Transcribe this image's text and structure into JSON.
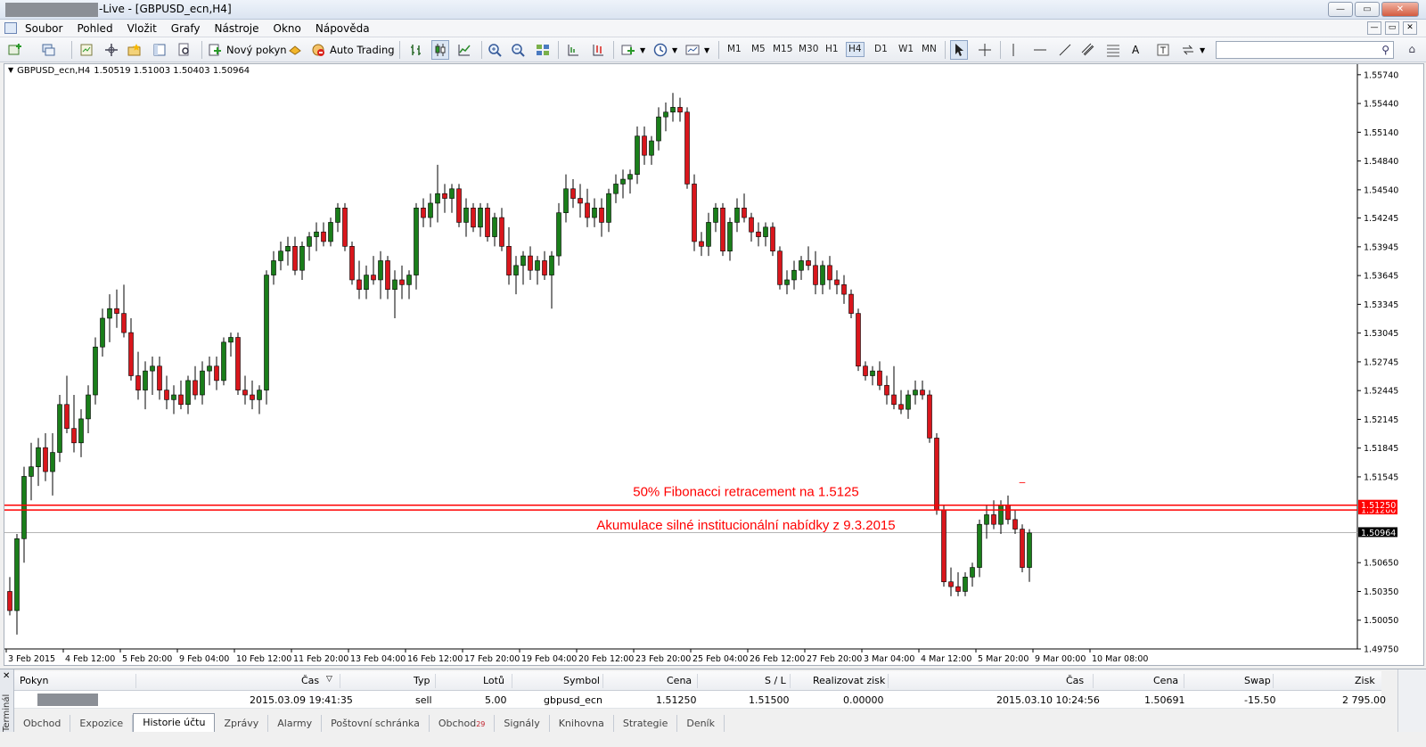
{
  "window": {
    "title": "-Live - [GBPUSD_ecn,H4]",
    "minimize": "—",
    "maximize": "▭",
    "close": "✕"
  },
  "menu": [
    "Soubor",
    "Pohled",
    "Vložit",
    "Grafy",
    "Nástroje",
    "Okno",
    "Nápověda"
  ],
  "toolbar": {
    "new_order": "Nový pokyn",
    "auto_trading": "Auto Trading",
    "timeframes": [
      "M1",
      "M5",
      "M15",
      "M30",
      "H1",
      "H4",
      "D1",
      "W1",
      "MN"
    ],
    "active_timeframe": "H4",
    "draw_text": "A"
  },
  "chart_header": {
    "symbol": "GBPUSD_ecn,H4",
    "ohlc": "1.50519 1.51003 1.50403 1.50964"
  },
  "annotations": {
    "fib": "50% Fibonacci retracement na 1.5125",
    "zone": "Akumulace silné institucionální nabídky z 9.3.2015",
    "marker_symbol": "–"
  },
  "colors": {
    "bull": "#1a7e1a",
    "bear": "#d9161c",
    "line_red": "#ff0000",
    "grid": "#ffffff",
    "price_bg": "#000000"
  },
  "chart_data": {
    "type": "candlestick",
    "ylim": [
      1.4975,
      1.5585
    ],
    "y_ticks": [
      "1.55740",
      "1.55440",
      "1.55140",
      "1.54840",
      "1.54540",
      "1.54245",
      "1.53945",
      "1.53645",
      "1.53345",
      "1.53045",
      "1.52745",
      "1.52445",
      "1.52145",
      "1.51845",
      "1.51545",
      "1.50650",
      "1.50350",
      "1.50050",
      "1.49750"
    ],
    "x_ticks": [
      "3 Feb 2015",
      "4 Feb 12:00",
      "5 Feb 20:00",
      "9 Feb 04:00",
      "10 Feb 12:00",
      "11 Feb 20:00",
      "13 Feb 04:00",
      "16 Feb 12:00",
      "17 Feb 20:00",
      "19 Feb 04:00",
      "20 Feb 12:00",
      "23 Feb 20:00",
      "25 Feb 04:00",
      "26 Feb 12:00",
      "27 Feb 20:00",
      "3 Mar 04:00",
      "4 Mar 12:00",
      "5 Mar 20:00",
      "9 Mar 00:00",
      "10 Mar 08:00"
    ],
    "hlines": [
      {
        "price": 1.5125,
        "label": "1.51250"
      },
      {
        "price": 1.512,
        "label": "1.51200"
      }
    ],
    "current_price": {
      "price": 1.50964,
      "label": "1.50964"
    },
    "candles": [
      [
        1.5035,
        1.505,
        1.501,
        1.5015
      ],
      [
        1.5015,
        1.5095,
        1.499,
        1.509
      ],
      [
        1.509,
        1.5165,
        1.5065,
        1.5155
      ],
      [
        1.5155,
        1.519,
        1.513,
        1.5165
      ],
      [
        1.5165,
        1.5195,
        1.5145,
        1.5185
      ],
      [
        1.5185,
        1.52,
        1.515,
        1.516
      ],
      [
        1.516,
        1.52,
        1.5135,
        1.518
      ],
      [
        1.518,
        1.524,
        1.517,
        1.523
      ],
      [
        1.523,
        1.526,
        1.52,
        1.5205
      ],
      [
        1.5205,
        1.524,
        1.518,
        1.519
      ],
      [
        1.519,
        1.5225,
        1.5175,
        1.5215
      ],
      [
        1.5215,
        1.525,
        1.52,
        1.524
      ],
      [
        1.524,
        1.53,
        1.523,
        1.529
      ],
      [
        1.529,
        1.533,
        1.528,
        1.532
      ],
      [
        1.532,
        1.5345,
        1.5295,
        1.533
      ],
      [
        1.533,
        1.535,
        1.531,
        1.5325
      ],
      [
        1.5325,
        1.5355,
        1.53,
        1.5305
      ],
      [
        1.5305,
        1.532,
        1.5255,
        1.526
      ],
      [
        1.526,
        1.5285,
        1.5235,
        1.5245
      ],
      [
        1.5245,
        1.5275,
        1.5225,
        1.5265
      ],
      [
        1.5265,
        1.528,
        1.524,
        1.527
      ],
      [
        1.527,
        1.528,
        1.5235,
        1.5245
      ],
      [
        1.5245,
        1.526,
        1.5225,
        1.5235
      ],
      [
        1.5235,
        1.525,
        1.522,
        1.524
      ],
      [
        1.524,
        1.5255,
        1.5225,
        1.523
      ],
      [
        1.523,
        1.526,
        1.522,
        1.5255
      ],
      [
        1.5255,
        1.527,
        1.5235,
        1.524
      ],
      [
        1.524,
        1.5275,
        1.523,
        1.5265
      ],
      [
        1.5265,
        1.528,
        1.525,
        1.527
      ],
      [
        1.527,
        1.528,
        1.5245,
        1.5255
      ],
      [
        1.5255,
        1.53,
        1.525,
        1.5295
      ],
      [
        1.5295,
        1.5305,
        1.528,
        1.53
      ],
      [
        1.53,
        1.5305,
        1.524,
        1.5245
      ],
      [
        1.5245,
        1.526,
        1.523,
        1.524
      ],
      [
        1.524,
        1.5255,
        1.5225,
        1.5235
      ],
      [
        1.5235,
        1.525,
        1.522,
        1.5245
      ],
      [
        1.5245,
        1.537,
        1.523,
        1.5365
      ],
      [
        1.5365,
        1.539,
        1.5355,
        1.538
      ],
      [
        1.538,
        1.54,
        1.537,
        1.539
      ],
      [
        1.539,
        1.5405,
        1.5375,
        1.5395
      ],
      [
        1.5395,
        1.5405,
        1.5365,
        1.537
      ],
      [
        1.537,
        1.54,
        1.536,
        1.5395
      ],
      [
        1.5395,
        1.541,
        1.538,
        1.5405
      ],
      [
        1.5405,
        1.542,
        1.539,
        1.541
      ],
      [
        1.541,
        1.542,
        1.5395,
        1.54
      ],
      [
        1.54,
        1.5425,
        1.5395,
        1.542
      ],
      [
        1.542,
        1.544,
        1.541,
        1.5435
      ],
      [
        1.5435,
        1.544,
        1.539,
        1.5395
      ],
      [
        1.5395,
        1.54,
        1.5355,
        1.536
      ],
      [
        1.536,
        1.538,
        1.534,
        1.535
      ],
      [
        1.535,
        1.5375,
        1.534,
        1.5365
      ],
      [
        1.5365,
        1.5385,
        1.5355,
        1.536
      ],
      [
        1.536,
        1.539,
        1.534,
        1.538
      ],
      [
        1.538,
        1.5385,
        1.534,
        1.535
      ],
      [
        1.535,
        1.537,
        1.532,
        1.536
      ],
      [
        1.536,
        1.5375,
        1.534,
        1.5355
      ],
      [
        1.5355,
        1.537,
        1.534,
        1.5365
      ],
      [
        1.5365,
        1.544,
        1.535,
        1.5435
      ],
      [
        1.5435,
        1.5445,
        1.5415,
        1.5425
      ],
      [
        1.5425,
        1.545,
        1.5415,
        1.544
      ],
      [
        1.544,
        1.548,
        1.542,
        1.545
      ],
      [
        1.545,
        1.546,
        1.543,
        1.5445
      ],
      [
        1.5445,
        1.546,
        1.543,
        1.5455
      ],
      [
        1.5455,
        1.546,
        1.5415,
        1.542
      ],
      [
        1.542,
        1.5445,
        1.5405,
        1.5435
      ],
      [
        1.5435,
        1.544,
        1.541,
        1.5415
      ],
      [
        1.5415,
        1.544,
        1.5405,
        1.5435
      ],
      [
        1.5435,
        1.544,
        1.54,
        1.5405
      ],
      [
        1.5405,
        1.543,
        1.5395,
        1.5425
      ],
      [
        1.5425,
        1.5435,
        1.539,
        1.5395
      ],
      [
        1.5395,
        1.5415,
        1.5355,
        1.5365
      ],
      [
        1.5365,
        1.5385,
        1.5345,
        1.5375
      ],
      [
        1.5375,
        1.539,
        1.5355,
        1.5385
      ],
      [
        1.5385,
        1.5395,
        1.536,
        1.537
      ],
      [
        1.537,
        1.5385,
        1.5355,
        1.538
      ],
      [
        1.538,
        1.539,
        1.536,
        1.5365
      ],
      [
        1.5365,
        1.539,
        1.533,
        1.5385
      ],
      [
        1.5385,
        1.544,
        1.5375,
        1.543
      ],
      [
        1.543,
        1.547,
        1.542,
        1.5455
      ],
      [
        1.5455,
        1.5465,
        1.5435,
        1.5445
      ],
      [
        1.5445,
        1.546,
        1.5425,
        1.544
      ],
      [
        1.544,
        1.5455,
        1.5415,
        1.5425
      ],
      [
        1.5425,
        1.5445,
        1.5415,
        1.5435
      ],
      [
        1.5435,
        1.5445,
        1.5405,
        1.542
      ],
      [
        1.542,
        1.5455,
        1.541,
        1.545
      ],
      [
        1.545,
        1.547,
        1.544,
        1.546
      ],
      [
        1.546,
        1.5475,
        1.5445,
        1.5465
      ],
      [
        1.5465,
        1.5475,
        1.545,
        1.547
      ],
      [
        1.547,
        1.552,
        1.546,
        1.551
      ],
      [
        1.551,
        1.552,
        1.548,
        1.549
      ],
      [
        1.549,
        1.551,
        1.548,
        1.5505
      ],
      [
        1.5505,
        1.554,
        1.5495,
        1.553
      ],
      [
        1.553,
        1.5545,
        1.5515,
        1.5535
      ],
      [
        1.5535,
        1.5555,
        1.5525,
        1.554
      ],
      [
        1.554,
        1.555,
        1.5525,
        1.5535
      ],
      [
        1.5535,
        1.554,
        1.5455,
        1.546
      ],
      [
        1.546,
        1.547,
        1.539,
        1.54
      ],
      [
        1.54,
        1.541,
        1.5385,
        1.5395
      ],
      [
        1.5395,
        1.543,
        1.5385,
        1.542
      ],
      [
        1.542,
        1.544,
        1.541,
        1.5435
      ],
      [
        1.5435,
        1.544,
        1.5385,
        1.539
      ],
      [
        1.539,
        1.5425,
        1.538,
        1.542
      ],
      [
        1.542,
        1.5445,
        1.541,
        1.5435
      ],
      [
        1.5435,
        1.545,
        1.542,
        1.5425
      ],
      [
        1.5425,
        1.543,
        1.54,
        1.541
      ],
      [
        1.541,
        1.542,
        1.5395,
        1.5405
      ],
      [
        1.5405,
        1.542,
        1.5395,
        1.5415
      ],
      [
        1.5415,
        1.542,
        1.5385,
        1.539
      ],
      [
        1.539,
        1.5395,
        1.535,
        1.5355
      ],
      [
        1.5355,
        1.537,
        1.5345,
        1.536
      ],
      [
        1.536,
        1.538,
        1.535,
        1.537
      ],
      [
        1.537,
        1.5385,
        1.536,
        1.538
      ],
      [
        1.538,
        1.5395,
        1.537,
        1.5375
      ],
      [
        1.5375,
        1.539,
        1.5345,
        1.5355
      ],
      [
        1.5355,
        1.538,
        1.5345,
        1.5375
      ],
      [
        1.5375,
        1.5385,
        1.535,
        1.536
      ],
      [
        1.536,
        1.537,
        1.5345,
        1.5355
      ],
      [
        1.5355,
        1.5365,
        1.5335,
        1.5345
      ],
      [
        1.5345,
        1.535,
        1.532,
        1.5325
      ],
      [
        1.5325,
        1.533,
        1.5265,
        1.527
      ],
      [
        1.527,
        1.5275,
        1.5255,
        1.526
      ],
      [
        1.526,
        1.527,
        1.525,
        1.5265
      ],
      [
        1.5265,
        1.5275,
        1.5245,
        1.525
      ],
      [
        1.525,
        1.526,
        1.523,
        1.524
      ],
      [
        1.524,
        1.527,
        1.5225,
        1.523
      ],
      [
        1.523,
        1.5245,
        1.522,
        1.5225
      ],
      [
        1.5225,
        1.5245,
        1.5215,
        1.524
      ],
      [
        1.524,
        1.5255,
        1.523,
        1.5245
      ],
      [
        1.5245,
        1.5255,
        1.5235,
        1.524
      ],
      [
        1.524,
        1.5245,
        1.519,
        1.5195
      ],
      [
        1.5195,
        1.52,
        1.5115,
        1.512
      ],
      [
        1.512,
        1.5125,
        1.504,
        1.5045
      ],
      [
        1.5045,
        1.506,
        1.503,
        1.504
      ],
      [
        1.504,
        1.5055,
        1.503,
        1.5035
      ],
      [
        1.5035,
        1.5055,
        1.503,
        1.505
      ],
      [
        1.505,
        1.5065,
        1.504,
        1.506
      ],
      [
        1.506,
        1.511,
        1.505,
        1.5105
      ],
      [
        1.5105,
        1.5125,
        1.509,
        1.5115
      ],
      [
        1.5115,
        1.513,
        1.51,
        1.5105
      ],
      [
        1.5105,
        1.513,
        1.5095,
        1.5125
      ],
      [
        1.5125,
        1.5135,
        1.5105,
        1.511
      ],
      [
        1.511,
        1.512,
        1.5095,
        1.51
      ],
      [
        1.51,
        1.5105,
        1.5055,
        1.506
      ],
      [
        1.506,
        1.51,
        1.5045,
        1.5096
      ]
    ],
    "bar_index_of_x_ticks": [
      0,
      8,
      16,
      24,
      32,
      40,
      48,
      56,
      64,
      72,
      80,
      88,
      96,
      104,
      112,
      120,
      128,
      136,
      144,
      152
    ]
  },
  "terminal": {
    "side_label": "Terminál",
    "close": "✕",
    "headers": {
      "pokyn": "Pokyn",
      "cas": "Čas",
      "typ": "Typ",
      "lotu": "Lotů",
      "symbol": "Symbol",
      "cena": "Cena",
      "sl": "S / L",
      "realizovat": "Realizovat zisk",
      "cas2": "Čas",
      "cena2": "Cena",
      "swap": "Swap",
      "zisk": "Zisk",
      "sort": "▽"
    },
    "row": {
      "cas": "2015.03.09 19:41:35",
      "typ": "sell",
      "lotu": "5.00",
      "symbol": "gbpusd_ecn",
      "cena": "1.51250",
      "sl": "1.51500",
      "realizovat": "0.00000",
      "cas2": "2015.03.10 10:24:56",
      "cena2": "1.50691",
      "swap": "-15.50",
      "zisk": "2 795.00"
    },
    "tabs": [
      "Obchod",
      "Expozice",
      "Historie účtu",
      "Zprávy",
      "Alarmy",
      "Poštovní schránka",
      "Obchod",
      "Signály",
      "Knihovna",
      "Strategie",
      "Deník"
    ],
    "active_tab": 2,
    "badge": "29"
  }
}
